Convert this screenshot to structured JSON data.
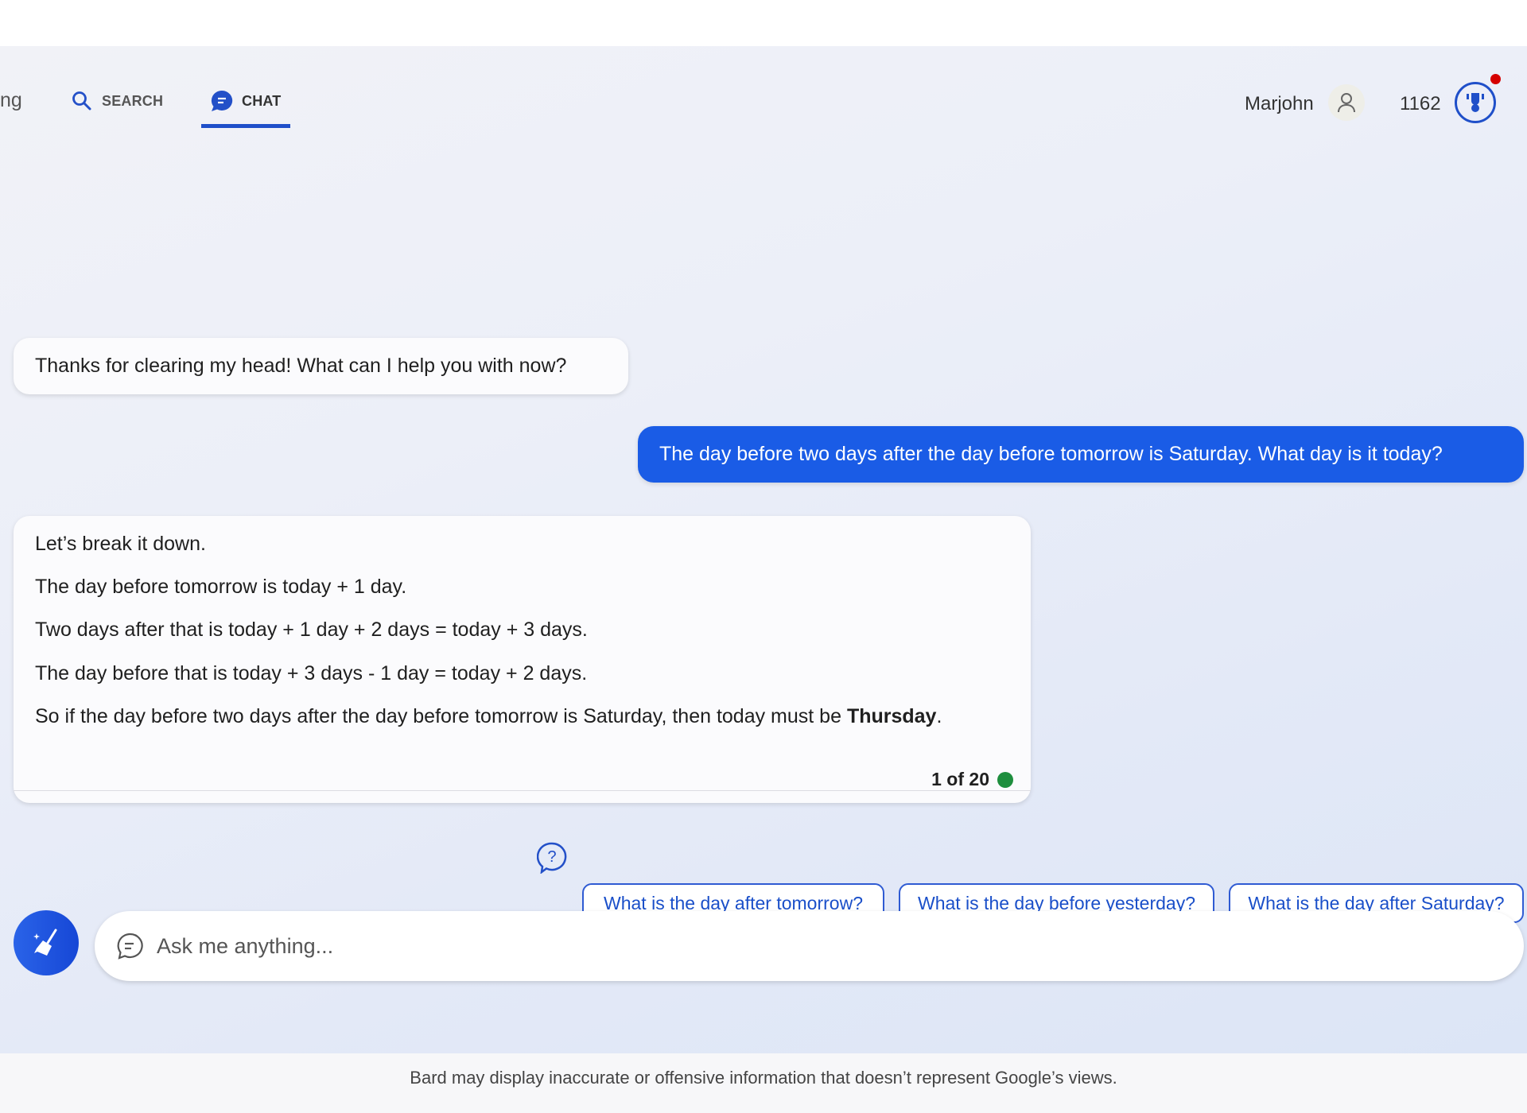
{
  "nav": {
    "partial_tab": "ng",
    "search_label": "SEARCH",
    "chat_label": "CHAT",
    "active_tab": "chat"
  },
  "user": {
    "name": "Marjohn",
    "points": "1162"
  },
  "colors": {
    "accent": "#1a5ce6",
    "success": "#1e8e3e",
    "notification": "#d50000"
  },
  "messages": {
    "bot_greeting": "Thanks for clearing my head! What can I help you with now?",
    "user_question": "The day before two days after the day before tomorrow is Saturday. What day is it today?",
    "bot_answer": {
      "lines": [
        "Let’s break it down.",
        "The day before tomorrow is today + 1 day.",
        "Two days after that is today + 1 day + 2 days = today + 3 days.",
        "The day before that is today + 3 days - 1 day = today + 2 days."
      ],
      "conclusion_prefix": "So if the day before two days after the day before tomorrow is Saturday, then today must be ",
      "conclusion_bold": "Thursday",
      "conclusion_suffix": ".",
      "counter": "1 of 20"
    }
  },
  "suggestions": [
    "What is the day after tomorrow?",
    "What is the day before yesterday?",
    "What is the day after Saturday?"
  ],
  "input": {
    "placeholder": "Ask me anything..."
  },
  "footer": "Bard may display inaccurate or offensive information that doesn’t represent Google’s views."
}
